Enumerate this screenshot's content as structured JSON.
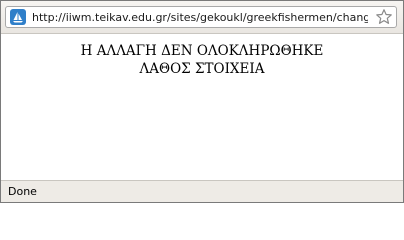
{
  "toolbar": {
    "url": "http://iiwm.teikav.edu.gr/sites/gekoukl/greekfishermen/chang",
    "site_icon": "sailboat-icon",
    "bookmark_icon": "star-icon"
  },
  "content": {
    "line1": "Η ΑΛΛΑΓΗ ΔΕΝ ΟΛΟΚΛΗΡΩΘΗΚΕ",
    "line2": "ΛΑΘΟΣ ΣΤΟΙΧΕΙΑ"
  },
  "status": {
    "text": "Done"
  },
  "colors": {
    "toolbar_bg": "#eeebe6",
    "window_border": "#7a7a7a",
    "icon_blue": "#2f7fc9"
  }
}
